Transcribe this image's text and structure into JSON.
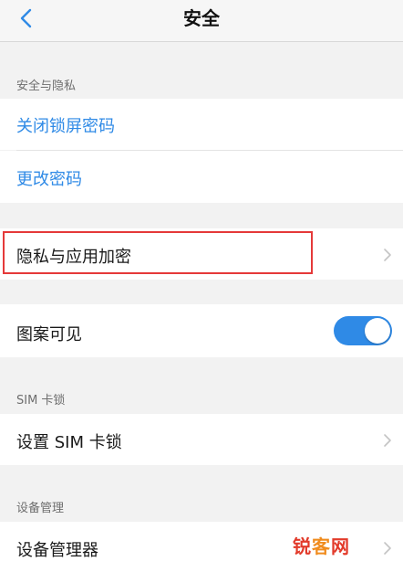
{
  "header": {
    "title": "安全"
  },
  "sections": {
    "security_privacy": {
      "header": "安全与隐私",
      "items": [
        {
          "label": "关闭锁屏密码"
        },
        {
          "label": "更改密码"
        }
      ]
    },
    "privacy_encryption": {
      "label": "隐私与应用加密"
    },
    "pattern_visible": {
      "label": "图案可见",
      "toggle_on": true,
      "toggle_color": "#2f8ae6"
    },
    "sim_lock": {
      "header": "SIM 卡锁",
      "item_label": "设置 SIM 卡锁"
    },
    "device_management": {
      "header": "设备管理",
      "item_label": "设备管理器"
    }
  },
  "watermark": {
    "part1": "锐",
    "part2": "客",
    "part3": "网"
  },
  "colors": {
    "accent": "#2f8ae6",
    "highlight_border": "#e53939",
    "background": "#f2f2f2"
  }
}
